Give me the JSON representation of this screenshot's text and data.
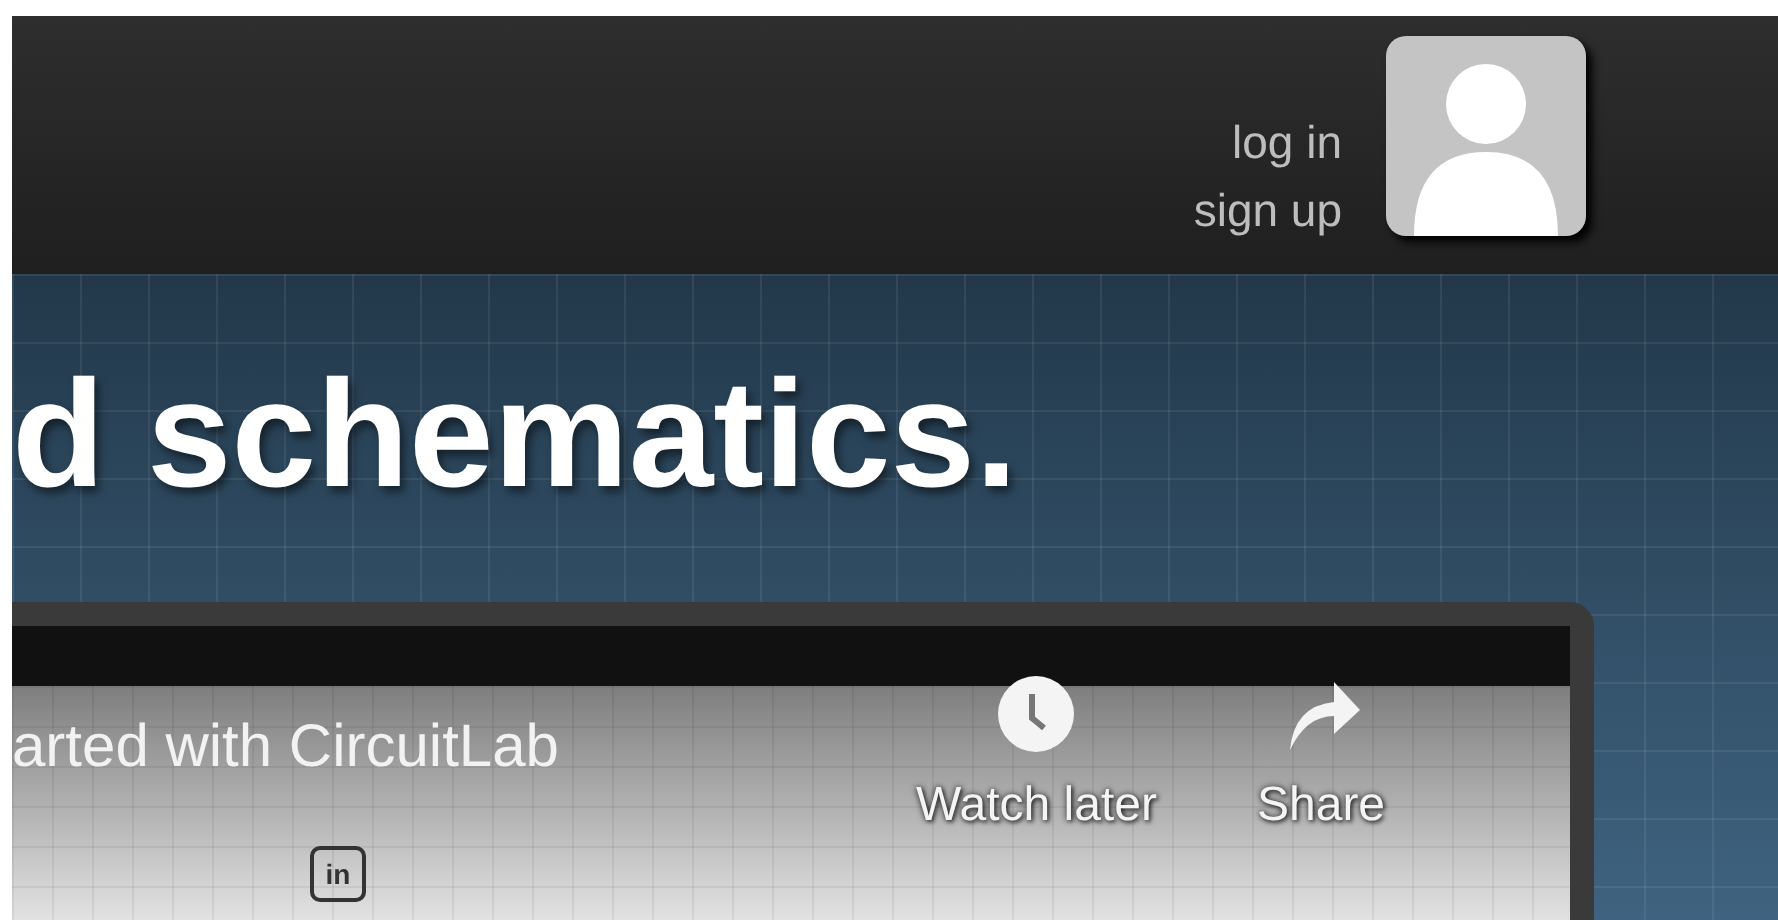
{
  "header": {
    "links": [
      {
        "label": "log in"
      },
      {
        "label": "sign up"
      }
    ]
  },
  "hero": {
    "heading": "d schematics."
  },
  "video": {
    "title": "arted with CircuitLab",
    "actions": [
      {
        "kind": "watch_later",
        "label": "Watch later"
      },
      {
        "kind": "share",
        "label": "Share"
      }
    ],
    "badge": "in"
  }
}
